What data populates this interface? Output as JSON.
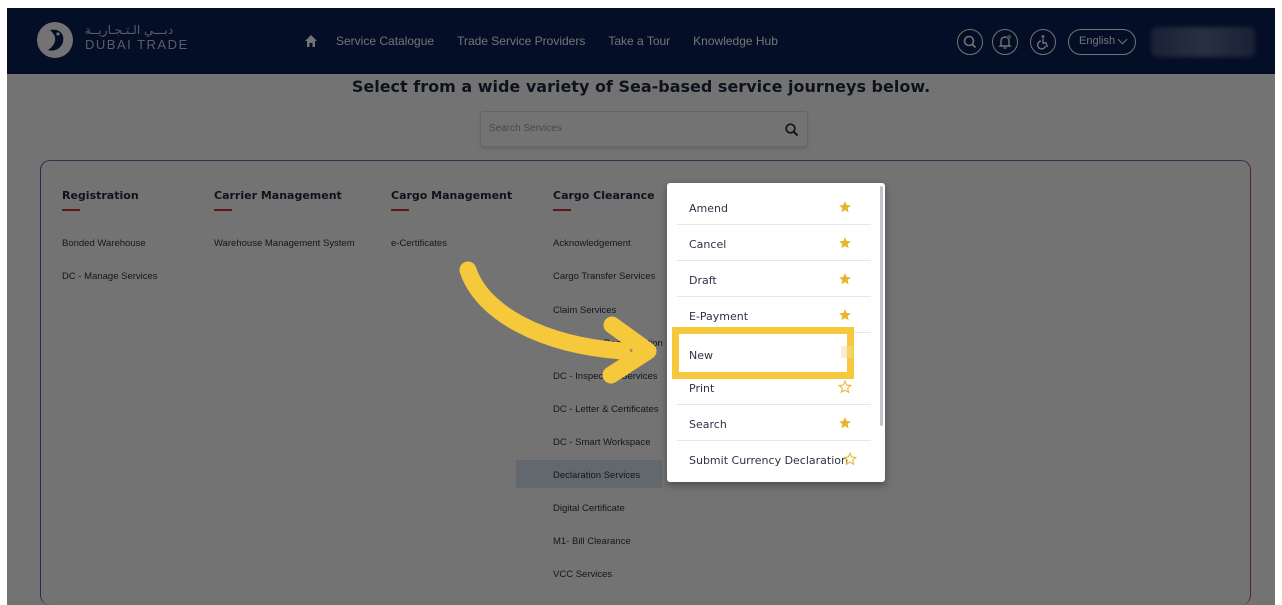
{
  "header": {
    "logo_arabic": "دبـــي الـتـجـاريــة",
    "logo_english": "DUBAI TRADE",
    "nav": [
      "Service Catalogue",
      "Trade Service Providers",
      "Take a Tour",
      "Knowledge Hub"
    ],
    "language": "English"
  },
  "main": {
    "headline": "Select from a wide variety of Sea-based service journeys below.",
    "search_placeholder": "Search Services"
  },
  "categories": [
    {
      "title": "Registration",
      "links": [
        "Bonded Warehouse",
        "DC - Manage Services"
      ]
    },
    {
      "title": "Carrier Management",
      "links": [
        "Warehouse Management System"
      ]
    },
    {
      "title": "Cargo Management",
      "links": [
        "e-Certificates"
      ]
    },
    {
      "title": "Cargo Clearance",
      "links": [
        "Acknowledgement",
        "Cargo Transfer Services",
        "Claim Services",
        "DC - Cargo Reconciliation",
        "DC - Inspection Services",
        "DC - Letter & Certificates",
        "DC - Smart Workspace",
        "Declaration Services",
        "Digital Certificate",
        "M1- Bill Clearance",
        "VCC Services"
      ]
    }
  ],
  "dropdown": {
    "items": [
      {
        "label": "Amend",
        "starred": true
      },
      {
        "label": "Cancel",
        "starred": true
      },
      {
        "label": "Draft",
        "starred": true
      },
      {
        "label": "E-Payment",
        "starred": true
      },
      {
        "label": "New",
        "starred": true
      },
      {
        "label": "Print",
        "starred": false
      },
      {
        "label": "Search",
        "starred": true
      },
      {
        "label": "Submit Currency Declaration",
        "starred": false
      }
    ]
  },
  "colors": {
    "header_bg": "#0b1f55",
    "accent_red": "#d6322d",
    "star_gold": "#e8b530",
    "highlight_yellow": "#f6c93c",
    "selected_row": "#dbe4f3"
  }
}
